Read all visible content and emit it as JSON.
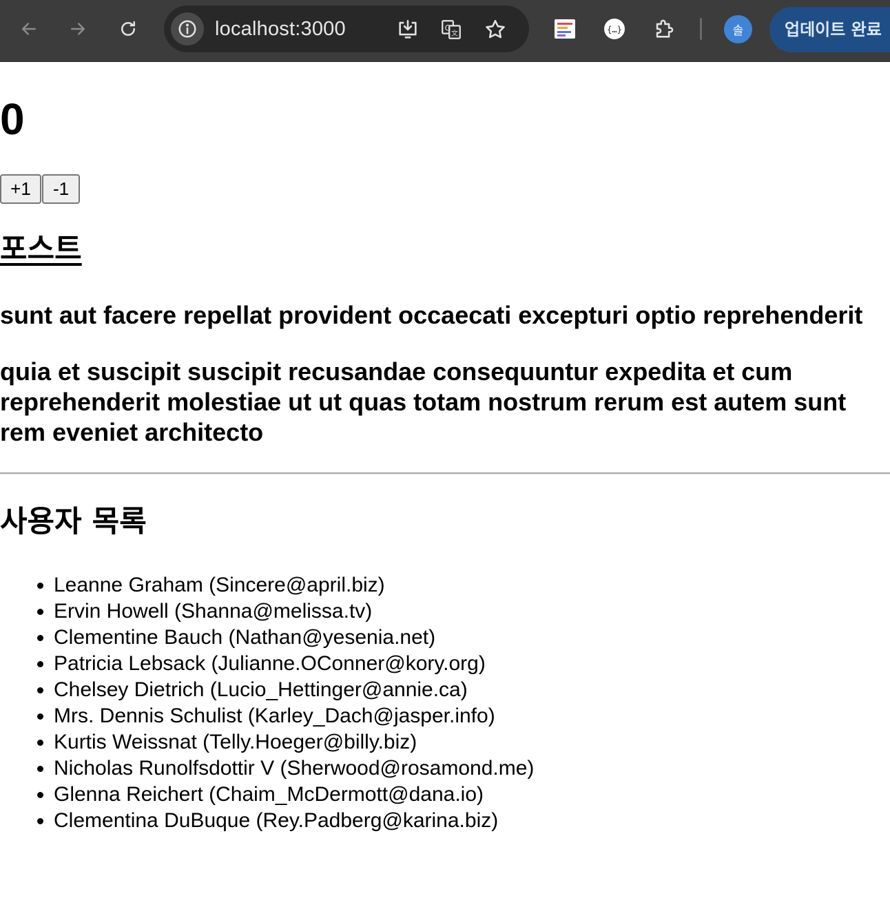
{
  "browser": {
    "url": "localhost:3000",
    "profile_initial": "솔",
    "update_label": "업데이트 완료",
    "colors": {
      "toolbar": "#3c3c3c",
      "omnibox": "#282828",
      "avatar": "#3f84d6",
      "update_button": "#1f4e87"
    }
  },
  "page": {
    "count": "0",
    "increment_label": "+1",
    "decrement_label": "-1",
    "posts_heading": "포스트",
    "post": {
      "title": "sunt aut facere repellat provident occaecati excepturi optio reprehenderit",
      "body": "quia et suscipit suscipit recusandae consequuntur expedita et cum reprehenderit molestiae ut ut quas totam nostrum rerum est autem sunt rem eveniet architecto"
    },
    "users_heading": "사용자 목록",
    "users": [
      "Leanne Graham (Sincere@april.biz)",
      "Ervin Howell (Shanna@melissa.tv)",
      "Clementine Bauch (Nathan@yesenia.net)",
      "Patricia Lebsack (Julianne.OConner@kory.org)",
      "Chelsey Dietrich (Lucio_Hettinger@annie.ca)",
      "Mrs. Dennis Schulist (Karley_Dach@jasper.info)",
      "Kurtis Weissnat (Telly.Hoeger@billy.biz)",
      "Nicholas Runolfsdottir V (Sherwood@rosamond.me)",
      "Glenna Reichert (Chaim_McDermott@dana.io)",
      "Clementina DuBuque (Rey.Padberg@karina.biz)"
    ]
  }
}
